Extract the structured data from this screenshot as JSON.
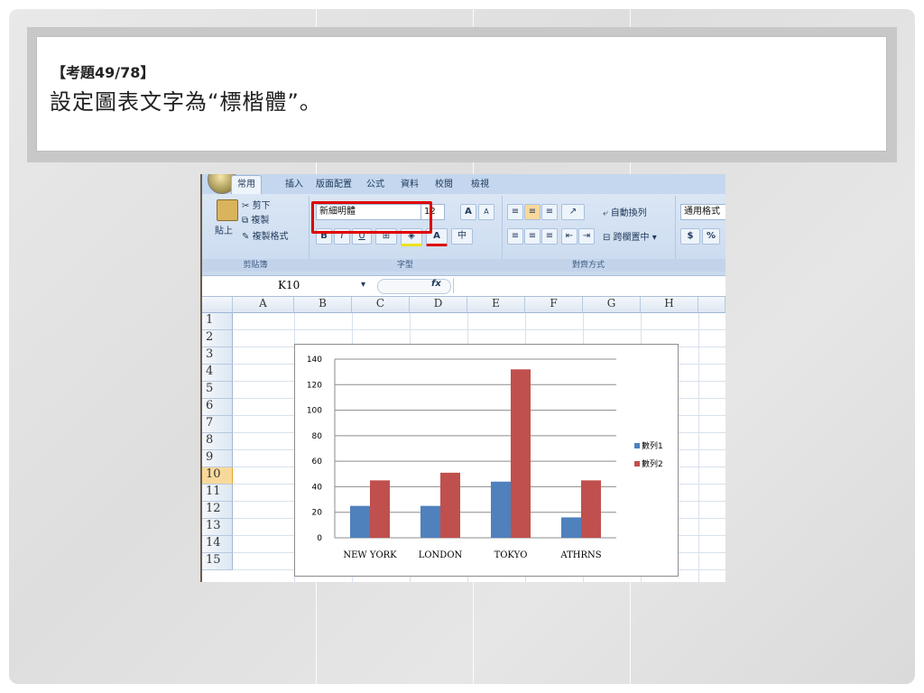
{
  "slide": {
    "question_number": "【考題49/78】",
    "question_text": "設定圖表文字為“標楷體”。"
  },
  "excel": {
    "tabs": [
      "常用",
      "插入",
      "版面配置",
      "公式",
      "資料",
      "校閱",
      "檢視"
    ],
    "active_tab": "常用",
    "clipboard": {
      "paste": "貼上",
      "cut": "剪下",
      "copy": "複製",
      "format_painter": "複製格式",
      "group_label": "剪貼簿"
    },
    "font": {
      "name": "新細明體",
      "size": "12",
      "grow": "A",
      "shrink": "A",
      "bold": "B",
      "italic": "I",
      "underline": "U",
      "group_label": "字型"
    },
    "alignment": {
      "wrap": "自動換列",
      "merge": "跨欄置中",
      "group_label": "對齊方式"
    },
    "number": {
      "format": "通用格式",
      "currency": "$",
      "percent": "%"
    },
    "formula_bar": {
      "cell": "K10",
      "fx": "fx"
    },
    "columns": [
      "A",
      "B",
      "C",
      "D",
      "E",
      "F",
      "G",
      "H"
    ],
    "rows": [
      "1",
      "2",
      "3",
      "4",
      "5",
      "6",
      "7",
      "8",
      "9",
      "10",
      "11",
      "12",
      "13",
      "14",
      "15"
    ],
    "selected_row": "10"
  },
  "chart_data": {
    "type": "bar",
    "categories": [
      "NEW YORK",
      "LONDON",
      "TOKYO",
      "ATHRNS"
    ],
    "series": [
      {
        "name": "數列1",
        "values": [
          25,
          25,
          44,
          16
        ],
        "color": "#4f81bd"
      },
      {
        "name": "數列2",
        "values": [
          45,
          51,
          132,
          45
        ],
        "color": "#c0504d"
      }
    ],
    "ylim": [
      0,
      140
    ],
    "yticks": [
      0,
      20,
      40,
      60,
      80,
      100,
      120,
      140
    ],
    "grid": true,
    "legend": "right"
  }
}
